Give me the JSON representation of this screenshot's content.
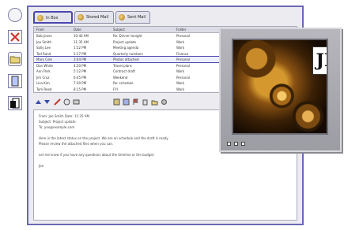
{
  "tabs": [
    {
      "label": "In Box"
    },
    {
      "label": "Stored Mail"
    },
    {
      "label": "Sent Mail"
    }
  ],
  "table": {
    "columns": [
      "From",
      "Date",
      "Subject",
      "Folder"
    ],
    "rows": [
      [
        "Bob Jones",
        "10:40 AM",
        "Re: Dinner tonight",
        "Personal"
      ],
      [
        "Joe Smith",
        "11:35 AM",
        "Project update",
        "Work"
      ],
      [
        "Sally Lee",
        "1:52 PM",
        "Meeting agenda",
        "Work"
      ],
      [
        "Ted Rand",
        "2:17 PM",
        "Quarterly numbers",
        "Finance"
      ],
      [
        "Mary Cole",
        "3:04 PM",
        "Photos attached",
        "Personal"
      ],
      [
        "Dan White",
        "4:20 PM",
        "Travel plans",
        "Personal"
      ],
      [
        "Ann Park",
        "5:12 PM",
        "Contract draft",
        "Work"
      ],
      [
        "Jim Cruz",
        "6:45 PM",
        "Weekend",
        "Personal"
      ],
      [
        "Lisa Kim",
        "7:30 PM",
        "Re: schedule",
        "Work"
      ],
      [
        "Tom Reed",
        "8:15 PM",
        "FYI",
        "Work"
      ]
    ]
  },
  "preview": {
    "lines": [
      "From: Joe Smith   Date: 11:35 AM",
      "Subject: Project update",
      "To: you@example.com",
      "",
      "Here is the latest status on the project. We are on schedule and the draft is ready.",
      "Please review the attached files when you can.",
      "",
      "Let me know if you have any questions about the timeline or the budget.",
      "",
      "Joe"
    ]
  },
  "logo": {
    "text": "JP"
  }
}
